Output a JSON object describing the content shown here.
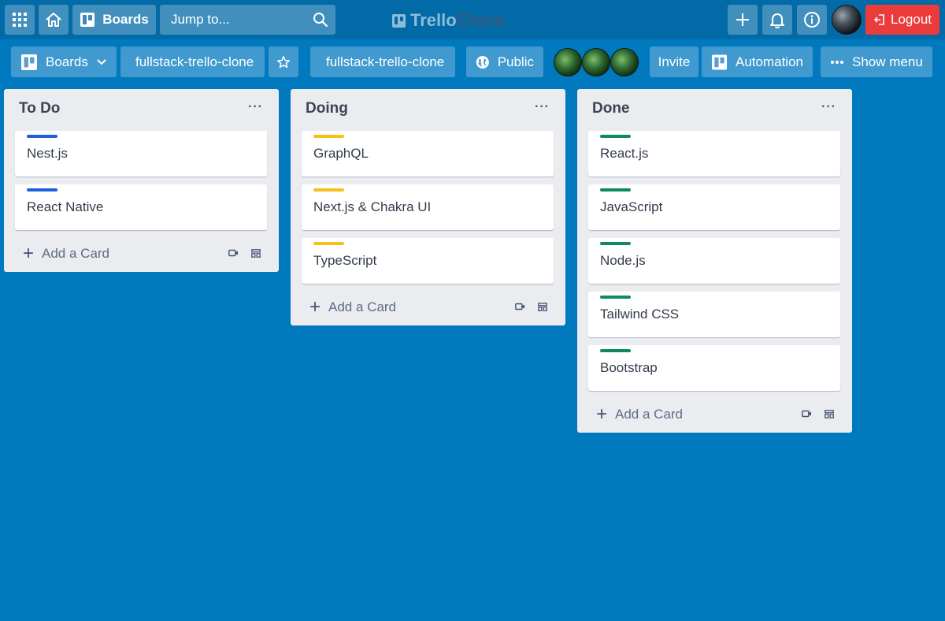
{
  "topbar": {
    "apps_icon": "grid-icon",
    "home_icon": "home-icon",
    "boards_label": "Boards",
    "search_placeholder": "Jump to...",
    "logo_part1": "Trello",
    "logo_part2": "Clone",
    "add_icon": "plus-icon",
    "notifications_icon": "bell-icon",
    "info_icon": "info-icon",
    "logout_label": "Logout"
  },
  "board_header": {
    "boards_label": "Boards",
    "board_name": "fullstack-trello-clone",
    "workspace_name": "fullstack-trello-clone",
    "visibility_label": "Public",
    "invite_label": "Invite",
    "automation_label": "Automation",
    "show_menu_label": "Show menu"
  },
  "lists": [
    {
      "title": "To Do",
      "menu": "···",
      "label_color": "#1f5fdc",
      "cards": [
        "Nest.js",
        "React Native"
      ],
      "add_card_label": "Add a Card"
    },
    {
      "title": "Doing",
      "menu": "···",
      "label_color": "#f5c21b",
      "cards": [
        "GraphQL",
        "Next.js & Chakra UI",
        "TypeScript"
      ],
      "add_card_label": "Add a Card"
    },
    {
      "title": "Done",
      "menu": "···",
      "label_color": "#0f8a5f",
      "cards": [
        "React.js",
        "JavaScript",
        "Node.js",
        "Tailwind CSS",
        "Bootstrap"
      ],
      "add_card_label": "Add a Card"
    }
  ],
  "colors": {
    "board_bg": "#0079bf",
    "topbar_bg": "#026aa7",
    "logout_bg": "#eb3b3b",
    "list_bg": "#ebecf0"
  }
}
